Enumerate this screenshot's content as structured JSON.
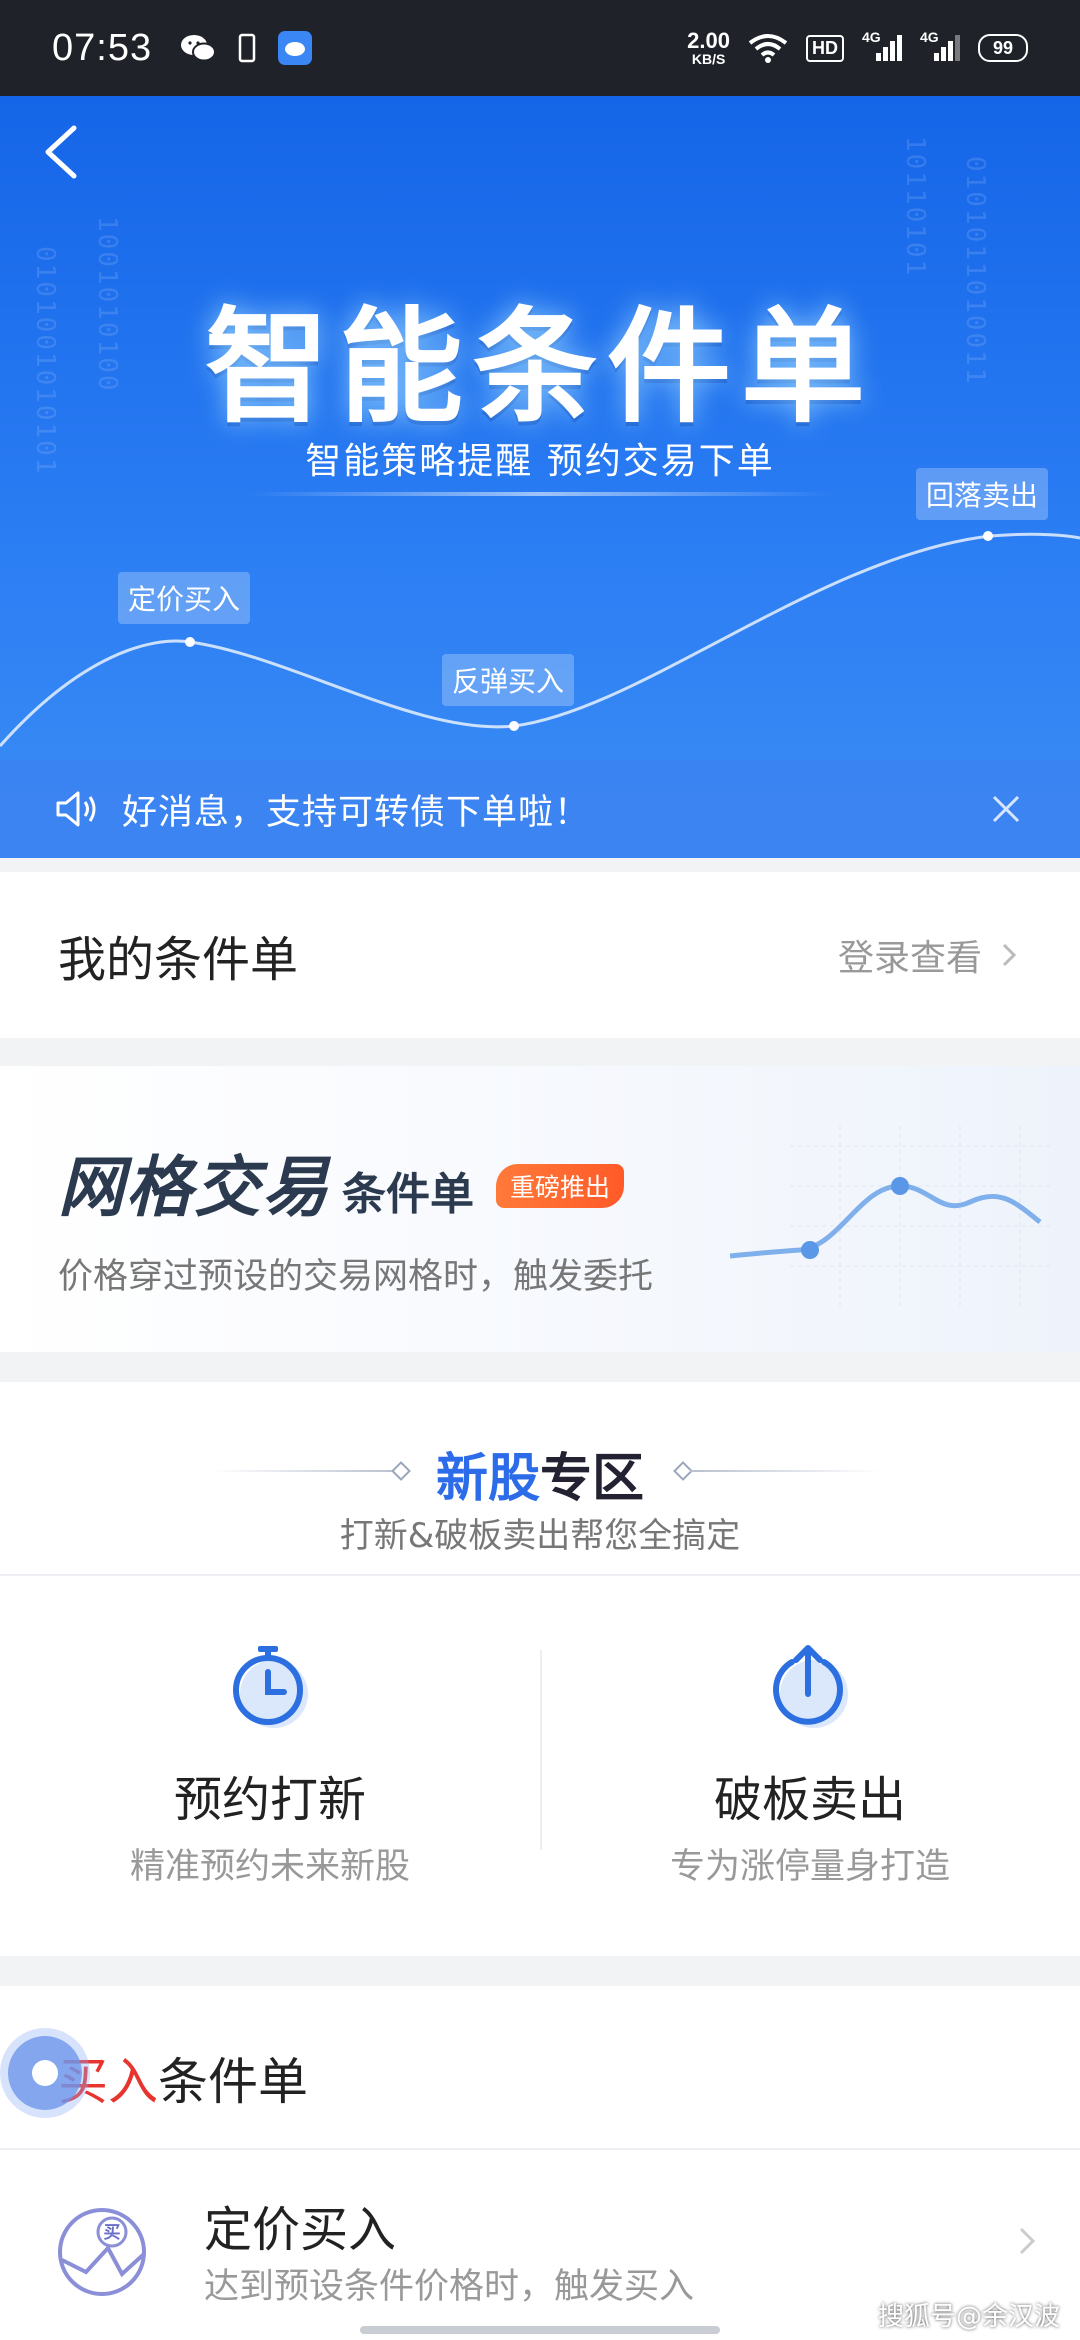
{
  "status_bar": {
    "time": "07:53",
    "net_speed_value": "2.00",
    "net_speed_unit": "KB/S",
    "hd_label": "HD",
    "signal1_label": "4G",
    "signal2_label": "4G",
    "battery": "99"
  },
  "banner": {
    "title": "智能条件单",
    "subtitle": "智能策略提醒 预约交易下单",
    "chips": [
      "定价买入",
      "反弹买入",
      "回落卖出"
    ],
    "notice": "好消息，支持可转债下单啦！",
    "colors": {
      "primary": "#1565e8"
    }
  },
  "my_orders": {
    "title": "我的条件单",
    "link": "登录查看"
  },
  "grid_trading": {
    "title": "网格交易",
    "title_suffix": "条件单",
    "badge": "重磅推出",
    "description": "价格穿过预设的交易网格时，触发委托"
  },
  "new_stock": {
    "heading_accent": "新股",
    "heading_rest": "专区",
    "subtitle": "打新&破板卖出帮您全搞定",
    "items": [
      {
        "title": "预约打新",
        "desc": "精准预约未来新股",
        "icon": "stopwatch-icon"
      },
      {
        "title": "破板卖出",
        "desc": "专为涨停量身打造",
        "icon": "upload-arrow-icon"
      }
    ]
  },
  "buy_orders": {
    "title_accent": "买入",
    "title_rest": "条件单",
    "rows": [
      {
        "title": "定价买入",
        "desc": "达到预设条件价格时，触发买入",
        "icon_text": "买"
      }
    ]
  },
  "watermark": "搜狐号@余汉波"
}
